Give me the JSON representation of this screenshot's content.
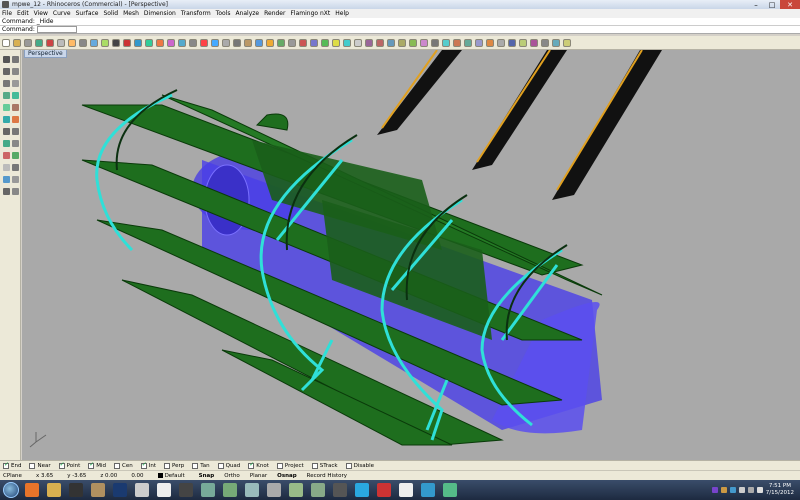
{
  "window": {
    "title": "mpwe_12 - Rhinoceros (Commercial) - [Perspective]",
    "controls": [
      "–",
      "□",
      "✕"
    ]
  },
  "menu": [
    "File",
    "Edit",
    "View",
    "Curve",
    "Surface",
    "Solid",
    "Mesh",
    "Dimension",
    "Transform",
    "Tools",
    "Analyze",
    "Render",
    "Flamingo nXt",
    "Help"
  ],
  "command": {
    "history": "Command: _Hide",
    "prompt": "Command:",
    "value": ""
  },
  "viewport": {
    "tab_label": "Perspective"
  },
  "osnaps": [
    {
      "label": "End",
      "checked": true
    },
    {
      "label": "Near",
      "checked": false
    },
    {
      "label": "Point",
      "checked": true
    },
    {
      "label": "Mid",
      "checked": true
    },
    {
      "label": "Cen",
      "checked": false
    },
    {
      "label": "Int",
      "checked": true
    },
    {
      "label": "Perp",
      "checked": false
    },
    {
      "label": "Tan",
      "checked": false
    },
    {
      "label": "Quad",
      "checked": false
    },
    {
      "label": "Knot",
      "checked": true
    },
    {
      "label": "Project",
      "checked": false
    },
    {
      "label": "STrack",
      "checked": false
    },
    {
      "label": "Disable",
      "checked": false
    }
  ],
  "status": {
    "cplane": "CPlane",
    "x": "x 3.65",
    "y": "y -3.65",
    "z": "z 0.00",
    "distance": "0.00",
    "layer": "Default",
    "panes": [
      "Snap",
      "Ortho",
      "Planar",
      "Osnap",
      "Record History"
    ]
  },
  "taskbar": {
    "time": "7:51 PM",
    "date": "7/15/2012"
  },
  "colors": {
    "green_rib": "#1e6e1e",
    "cyan_edge": "#2fe0d8",
    "blue_body": "#4a3fe8",
    "orange_rod": "#e0a020"
  },
  "icons": [
    "select-arrow-icon",
    "point-icon",
    "line-icon",
    "rectangle-icon",
    "circle-icon",
    "arc-icon",
    "polygon-icon",
    "curve-icon",
    "sphere-icon",
    "box-icon",
    "extrude-icon",
    "fillet-icon",
    "boolean-icon",
    "move-icon",
    "copy-icon",
    "rotate-icon",
    "scale-icon",
    "dimension-icon",
    "text-icon",
    "zoom-icon"
  ]
}
